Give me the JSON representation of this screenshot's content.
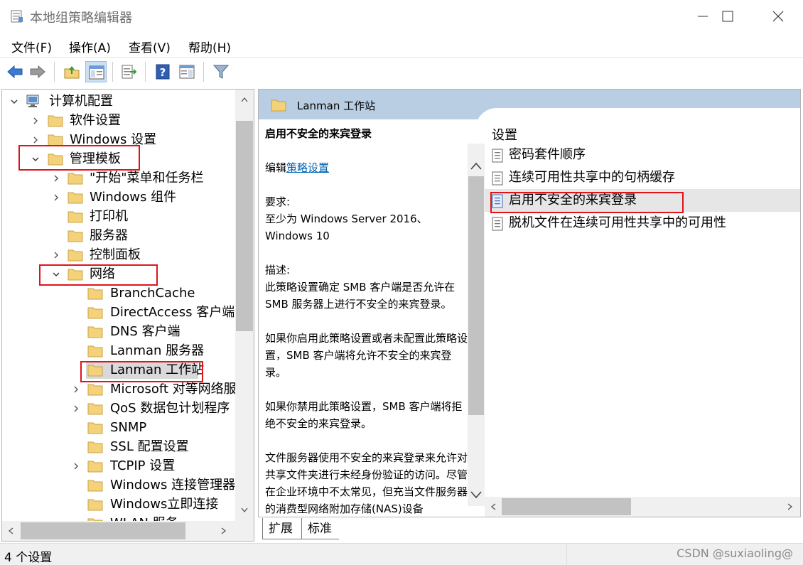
{
  "window": {
    "title": "本地组策略编辑器"
  },
  "menu": {
    "file": "文件(F)",
    "action": "操作(A)",
    "view": "查看(V)",
    "help": "帮助(H)"
  },
  "toolbar": {
    "icons": [
      "back-arrow-icon",
      "forward-arrow-icon",
      "up-folder-icon",
      "show-hide-tree-icon",
      "export-list-icon",
      "help-icon",
      "show-hide-action-pane-icon",
      "filter-icon"
    ]
  },
  "tree": {
    "computer_config": "计算机配置",
    "software_settings": "软件设置",
    "windows_settings": "Windows 设置",
    "admin_templates": "管理模板",
    "start_menu": "\"开始\"菜单和任务栏",
    "windows_components": "Windows 组件",
    "printers": "打印机",
    "server": "服务器",
    "control_panel": "控制面板",
    "network": "网络",
    "branchcache": "BranchCache",
    "directaccess": "DirectAccess 客户端体",
    "dns_client": "DNS 客户端",
    "lanman_server": "Lanman 服务器",
    "lanman_workstation": "Lanman 工作站",
    "microsoft_p2p": "Microsoft 对等网络服务",
    "qos": "QoS 数据包计划程序",
    "snmp": "SNMP",
    "ssl": "SSL 配置设置",
    "tcpip": "TCPIP 设置",
    "wcm": "Windows 连接管理器",
    "wcn": "Windows立即连接",
    "wlan": "WLAN 服务"
  },
  "details": {
    "header": "Lanman 工作站",
    "policy_title": "启用不安全的来宾登录",
    "edit_prefix": "编辑",
    "edit_link": "策略设置",
    "requirements_label": "要求:",
    "requirements_line1": "至少为 Windows Server 2016、",
    "requirements_line2": "Windows 10",
    "description_label": "描述:",
    "desc_p1": "此策略设置确定 SMB 客户端是否允许在 SMB 服务器上进行不安全的来宾登录。",
    "desc_p2": "如果你启用此策略设置或者未配置此策略设置，SMB 客户端将允许不安全的来宾登录。",
    "desc_p3": "如果你禁用此策略设置，SMB 客户端将拒绝不安全的来宾登录。",
    "desc_p4": "文件服务器使用不安全的来宾登录来允许对共享文件夹进行未经身份验证的访问。尽管在企业环境中不太常见，但充当文件服务器的消费型网络附加存储(NAS)设备"
  },
  "settings": {
    "header": "设置",
    "items": [
      "密码套件顺序",
      "连续可用性共享中的句柄缓存",
      "启用不安全的来宾登录",
      "脱机文件在连续可用性共享中的可用性"
    ],
    "selected_index": 2
  },
  "tabs": {
    "extended": "扩展",
    "standard": "标准"
  },
  "status": {
    "count_text": "4 个设置",
    "watermark": "CSDN @suxiaoling@"
  },
  "colors": {
    "highlight_red": "#e0131b",
    "header_band": "#b9cde3",
    "link_blue": "#0063b1",
    "folder_yellow": "#f4d27a"
  }
}
